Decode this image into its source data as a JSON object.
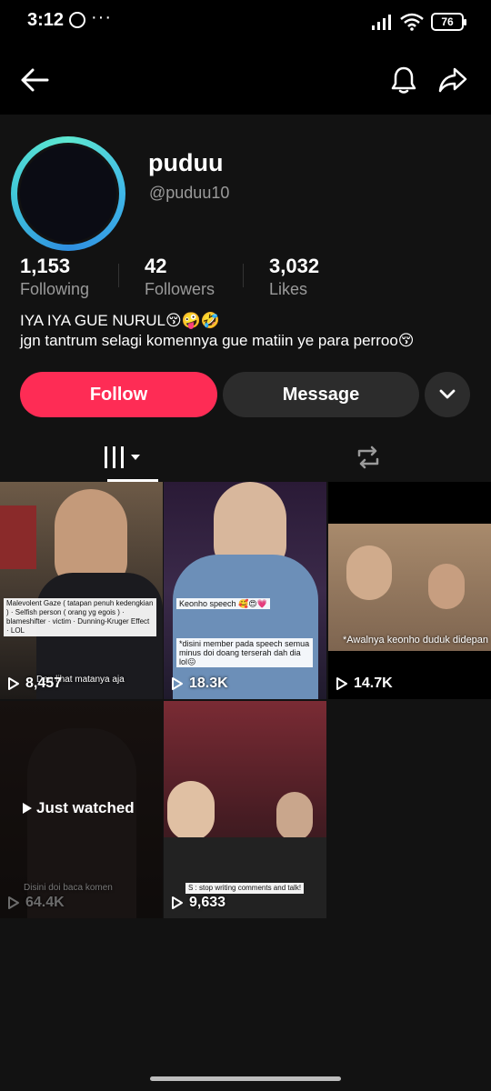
{
  "status_bar": {
    "time": "3:12",
    "dots": "···",
    "battery": "76"
  },
  "profile": {
    "name": "puduu",
    "handle": "@puduu10",
    "stats": [
      {
        "value": "1,153",
        "label": "Following"
      },
      {
        "value": "42",
        "label": "Followers"
      },
      {
        "value": "3,032",
        "label": "Likes"
      }
    ],
    "bio_line1": "IYA IYA GUE NURUL😚🤪🤣",
    "bio_line2": "jgn tantrum selagi komennya gue matiin ye para perroo😚"
  },
  "actions": {
    "follow_label": "Follow",
    "message_label": "Message"
  },
  "videos": [
    {
      "views": "8,457",
      "caption": "Malevolent Gaze ( tatapan penuh kedengkian ) · Selfish person ( orang yg egois ) · blameshifter · victim · Dunning-Kruger Effect · LOL",
      "overlay": "Dan lihat matanya aja"
    },
    {
      "views": "18.3K",
      "caption": "Keonho speech 🥰😍💗",
      "caption2": "*disini member pada speech semua minus doi doang terserah dah dia lol😖"
    },
    {
      "views": "14.7K",
      "caption": "*Awalnya keonho duduk didepan"
    },
    {
      "views": "64.4K",
      "overlay": "Disini doi baca komen",
      "just_watched": "Just watched"
    },
    {
      "views": "9,633",
      "caption": "S : stop writing comments and talk!"
    }
  ],
  "colors": {
    "follow": "#fe2c55",
    "ring_start": "#5de7d0",
    "ring_end": "#2f8fe0"
  }
}
